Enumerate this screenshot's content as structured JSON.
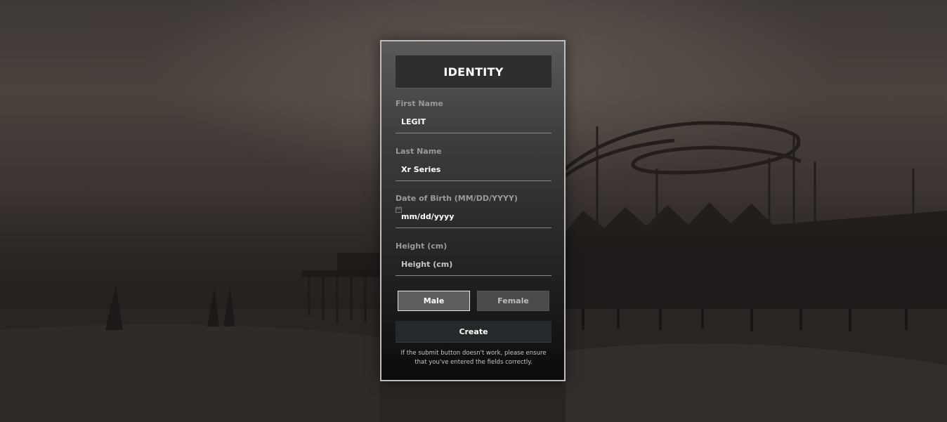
{
  "form": {
    "title": "IDENTITY",
    "first_name": {
      "label": "First Name",
      "value": "LEGIT"
    },
    "last_name": {
      "label": "Last Name",
      "value": "Xr Series"
    },
    "dob": {
      "label": "Date of Birth (MM/DD/YYYY)",
      "placeholder": "mm/dd/yyyy",
      "icon": "calendar-icon"
    },
    "height": {
      "label": "Height (cm)",
      "placeholder": "Height (cm)"
    },
    "gender": {
      "male": "Male",
      "female": "Female",
      "selected": "Male"
    },
    "create_label": "Create",
    "note_line1": "If the submit button doesn't work, please ensure",
    "note_line2": "that you've entered the fields correctly."
  },
  "colors": {
    "panel_border": "#bdbdbd",
    "header_bg": "#2e2e2e",
    "create_bg": "#26292b",
    "selected_gender_bg": "#5e5e5e"
  }
}
